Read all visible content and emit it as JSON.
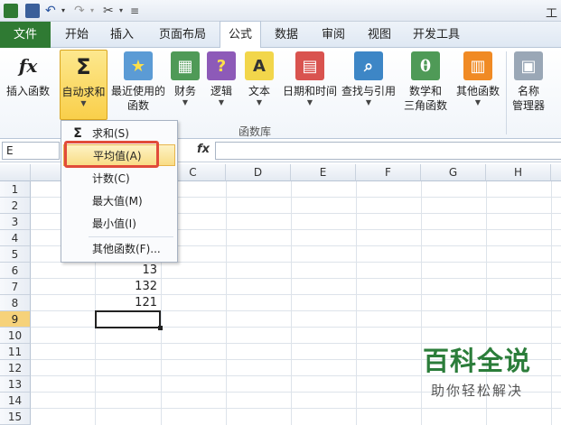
{
  "app": {
    "title_partial": "工"
  },
  "tabs": [
    "文件",
    "开始",
    "插入",
    "页面布局",
    "公式",
    "数据",
    "审阅",
    "视图",
    "开发工具"
  ],
  "ribbon": {
    "buttons": [
      {
        "label1": "插入函数",
        "label2": "",
        "icon": "fx-icon"
      },
      {
        "label1": "自动求和",
        "label2": "",
        "icon": "sigma-icon"
      },
      {
        "label1": "最近使用的",
        "label2": "函数",
        "icon": "book-star-icon"
      },
      {
        "label1": "财务",
        "label2": "",
        "icon": "book-finance-icon"
      },
      {
        "label1": "逻辑",
        "label2": "",
        "icon": "book-logic-icon"
      },
      {
        "label1": "文本",
        "label2": "",
        "icon": "book-text-icon"
      },
      {
        "label1": "日期和时间",
        "label2": "",
        "icon": "book-date-icon"
      },
      {
        "label1": "查找与引用",
        "label2": "",
        "icon": "book-lookup-icon"
      },
      {
        "label1": "数学和",
        "label2": "三角函数",
        "icon": "book-math-icon"
      },
      {
        "label1": "其他函数",
        "label2": "",
        "icon": "book-more-icon"
      },
      {
        "label1": "名称",
        "label2": "管理器",
        "icon": "name-manager-icon"
      }
    ],
    "group_label": "函数库"
  },
  "formula_bar": {
    "name_box": "E",
    "fx": "fx"
  },
  "columns": [
    "C",
    "D",
    "E",
    "F",
    "G",
    "H"
  ],
  "rows": [
    "1",
    "2",
    "3",
    "4",
    "5",
    "6",
    "7",
    "8",
    "9",
    "10",
    "11",
    "12",
    "13",
    "14",
    "15"
  ],
  "cells": {
    "B6": "13",
    "B7": "132",
    "B8": "121"
  },
  "autosum_menu": {
    "items": [
      {
        "label": "求和(S)",
        "icon": "Σ"
      },
      {
        "label": "平均值(A)",
        "icon": ""
      },
      {
        "label": "计数(C)",
        "icon": ""
      },
      {
        "label": "最大值(M)",
        "icon": ""
      },
      {
        "label": "最小值(I)",
        "icon": ""
      },
      {
        "label": "其他函数(F)...",
        "icon": ""
      }
    ]
  },
  "watermark": {
    "title": "百科全说",
    "subtitle": "助你轻松解决"
  },
  "colors": {
    "file_tab": "#2f7a33",
    "highlight_box": "#e14b3a",
    "selected_button": "#f9cf4a",
    "watermark": "#2b7d3a"
  }
}
